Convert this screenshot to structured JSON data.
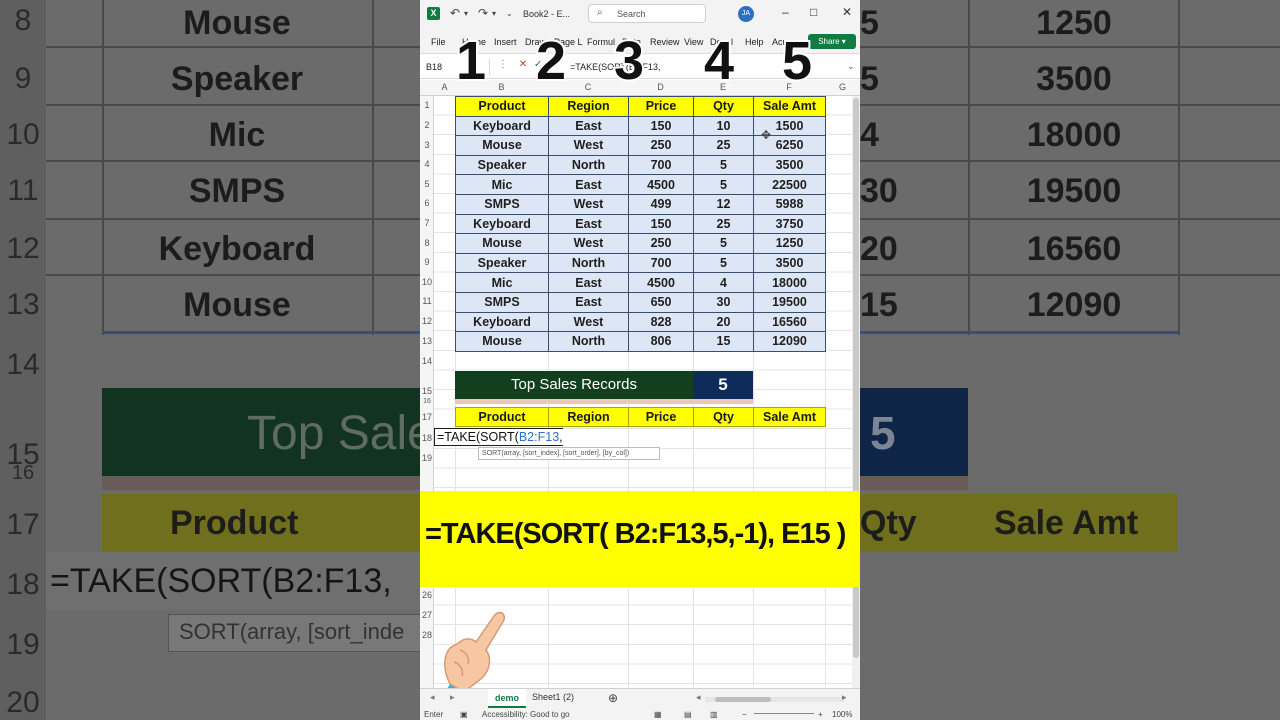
{
  "window": {
    "book_title": "Book2 - E...",
    "search_label": "Search",
    "avatar": "JA",
    "menu": [
      "File",
      "Home",
      "Insert",
      "Draw",
      "Page L",
      "Formul",
      "Data",
      "Review",
      "View",
      "Devel",
      "Help",
      "Acro"
    ],
    "share_label": "Share",
    "name_box": "B18",
    "formula_bar": "=TAKE(SORT(B2:F13,"
  },
  "columns": [
    "A",
    "B",
    "C",
    "D",
    "E",
    "F",
    "G"
  ],
  "rows_top": [
    "1",
    "2",
    "3",
    "4",
    "5",
    "6",
    "7",
    "8",
    "9",
    "10",
    "11",
    "12",
    "13",
    "14",
    "15",
    "16",
    "17",
    "18",
    "19"
  ],
  "rows_bottom": [
    "26",
    "27",
    "28"
  ],
  "table": {
    "headers": [
      "Product",
      "Region",
      "Price",
      "Qty",
      "Sale Amt"
    ],
    "rows": [
      [
        "Keyboard",
        "East",
        "150",
        "10",
        "1500"
      ],
      [
        "Mouse",
        "West",
        "250",
        "25",
        "6250"
      ],
      [
        "Speaker",
        "North",
        "700",
        "5",
        "3500"
      ],
      [
        "Mic",
        "East",
        "4500",
        "5",
        "22500"
      ],
      [
        "SMPS",
        "West",
        "499",
        "12",
        "5988"
      ],
      [
        "Keyboard",
        "East",
        "150",
        "25",
        "3750"
      ],
      [
        "Mouse",
        "West",
        "250",
        "5",
        "1250"
      ],
      [
        "Speaker",
        "North",
        "700",
        "5",
        "3500"
      ],
      [
        "Mic",
        "East",
        "4500",
        "4",
        "18000"
      ],
      [
        "SMPS",
        "East",
        "650",
        "30",
        "19500"
      ],
      [
        "Keyboard",
        "West",
        "828",
        "20",
        "16560"
      ],
      [
        "Mouse",
        "North",
        "806",
        "15",
        "12090"
      ]
    ]
  },
  "top_sales": {
    "label": "Top Sales Records",
    "value": "5"
  },
  "result_headers": [
    "Product",
    "Region",
    "Price",
    "Qty",
    "Sale Amt"
  ],
  "cell_formula": {
    "prefix": "=TAKE(SORT(",
    "range": "B2:F13",
    "suffix": ","
  },
  "fn_tooltip": "SORT(array, [sort_index], [sort_order], [by_col])",
  "overlay_formula": "=TAKE(SORT( B2:F13,5,-1), E15 )",
  "big_numbers": [
    "1",
    "2",
    "3",
    "4",
    "5"
  ],
  "sheet_tabs": {
    "active": "demo",
    "other": "Sheet1 (2)"
  },
  "status": {
    "mode": "Enter",
    "accessibility": "Accessibility: Good to go",
    "zoom": "100%"
  },
  "background": {
    "row_numbers": [
      "8",
      "9",
      "10",
      "11",
      "12",
      "13",
      "14",
      "15",
      "16",
      "17",
      "18",
      "19",
      "20"
    ],
    "products": [
      "Mouse",
      "Speaker",
      "Mic",
      "SMPS",
      "Keyboard",
      "Mouse"
    ],
    "qty": [
      "5",
      "5",
      "4",
      "30",
      "20",
      "15"
    ],
    "sale_amt": [
      "1250",
      "3500",
      "18000",
      "19500",
      "16560",
      "12090"
    ],
    "top_sales_text": "Top Sale",
    "top_sales_num": "5",
    "header_product": "Product",
    "header_qty": "Qty",
    "header_sale_amt": "Sale Amt",
    "formula_text": "=TAKE(SORT(B2:F13,",
    "tooltip_text": "SORT(array, [sort_inde"
  },
  "colors": {
    "excel_green": "#107c41",
    "header_yellow": "#ffff00",
    "dark_green": "#12401f",
    "navy": "#0d2c5c",
    "table_fill": "#dde6f4"
  }
}
